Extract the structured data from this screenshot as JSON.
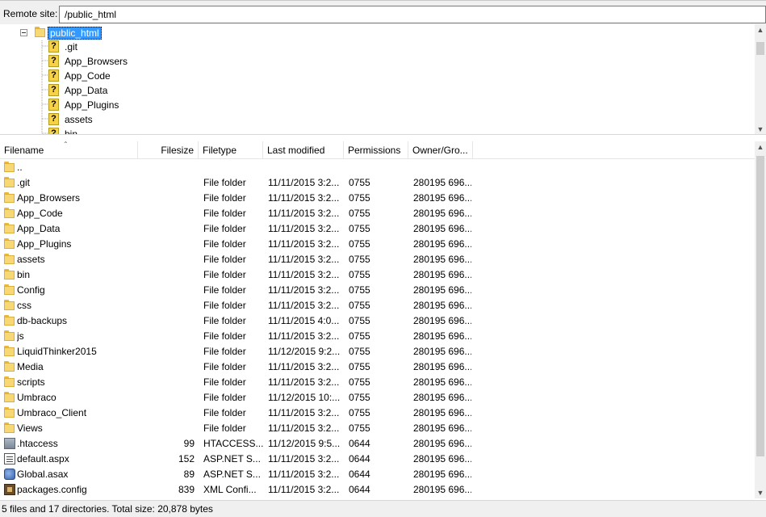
{
  "remote_site": {
    "label": "Remote site:",
    "path": "/public_html"
  },
  "tree": {
    "root": "public_html",
    "children": [
      ".git",
      "App_Browsers",
      "App_Code",
      "App_Data",
      "App_Plugins",
      "assets",
      "bin"
    ]
  },
  "file_list": {
    "columns": [
      "Filename",
      "Filesize",
      "Filetype",
      "Last modified",
      "Permissions",
      "Owner/Gro..."
    ],
    "rows": [
      {
        "name": "..",
        "size": "",
        "type": "",
        "modified": "",
        "perms": "",
        "owner": "",
        "icon": "folder-icon"
      },
      {
        "name": ".git",
        "size": "",
        "type": "File folder",
        "modified": "11/11/2015 3:2...",
        "perms": "0755",
        "owner": "280195 696...",
        "icon": "folder-icon"
      },
      {
        "name": "App_Browsers",
        "size": "",
        "type": "File folder",
        "modified": "11/11/2015 3:2...",
        "perms": "0755",
        "owner": "280195 696...",
        "icon": "folder-icon"
      },
      {
        "name": "App_Code",
        "size": "",
        "type": "File folder",
        "modified": "11/11/2015 3:2...",
        "perms": "0755",
        "owner": "280195 696...",
        "icon": "folder-icon"
      },
      {
        "name": "App_Data",
        "size": "",
        "type": "File folder",
        "modified": "11/11/2015 3:2...",
        "perms": "0755",
        "owner": "280195 696...",
        "icon": "folder-icon"
      },
      {
        "name": "App_Plugins",
        "size": "",
        "type": "File folder",
        "modified": "11/11/2015 3:2...",
        "perms": "0755",
        "owner": "280195 696...",
        "icon": "folder-icon"
      },
      {
        "name": "assets",
        "size": "",
        "type": "File folder",
        "modified": "11/11/2015 3:2...",
        "perms": "0755",
        "owner": "280195 696...",
        "icon": "folder-icon"
      },
      {
        "name": "bin",
        "size": "",
        "type": "File folder",
        "modified": "11/11/2015 3:2...",
        "perms": "0755",
        "owner": "280195 696...",
        "icon": "folder-icon"
      },
      {
        "name": "Config",
        "size": "",
        "type": "File folder",
        "modified": "11/11/2015 3:2...",
        "perms": "0755",
        "owner": "280195 696...",
        "icon": "folder-icon"
      },
      {
        "name": "css",
        "size": "",
        "type": "File folder",
        "modified": "11/11/2015 3:2...",
        "perms": "0755",
        "owner": "280195 696...",
        "icon": "folder-icon"
      },
      {
        "name": "db-backups",
        "size": "",
        "type": "File folder",
        "modified": "11/11/2015 4:0...",
        "perms": "0755",
        "owner": "280195 696...",
        "icon": "folder-icon"
      },
      {
        "name": "js",
        "size": "",
        "type": "File folder",
        "modified": "11/11/2015 3:2...",
        "perms": "0755",
        "owner": "280195 696...",
        "icon": "folder-icon"
      },
      {
        "name": "LiquidThinker2015",
        "size": "",
        "type": "File folder",
        "modified": "11/12/2015 9:2...",
        "perms": "0755",
        "owner": "280195 696...",
        "icon": "folder-icon"
      },
      {
        "name": "Media",
        "size": "",
        "type": "File folder",
        "modified": "11/11/2015 3:2...",
        "perms": "0755",
        "owner": "280195 696...",
        "icon": "folder-icon"
      },
      {
        "name": "scripts",
        "size": "",
        "type": "File folder",
        "modified": "11/11/2015 3:2...",
        "perms": "0755",
        "owner": "280195 696...",
        "icon": "folder-icon"
      },
      {
        "name": "Umbraco",
        "size": "",
        "type": "File folder",
        "modified": "11/12/2015 10:...",
        "perms": "0755",
        "owner": "280195 696...",
        "icon": "folder-icon"
      },
      {
        "name": "Umbraco_Client",
        "size": "",
        "type": "File folder",
        "modified": "11/11/2015 3:2...",
        "perms": "0755",
        "owner": "280195 696...",
        "icon": "folder-icon"
      },
      {
        "name": "Views",
        "size": "",
        "type": "File folder",
        "modified": "11/11/2015 3:2...",
        "perms": "0755",
        "owner": "280195 696...",
        "icon": "folder-icon"
      },
      {
        "name": ".htaccess",
        "size": "99",
        "type": "HTACCESS...",
        "modified": "11/12/2015 9:5...",
        "perms": "0644",
        "owner": "280195 696...",
        "icon": "htaccess-file-icon"
      },
      {
        "name": "default.aspx",
        "size": "152",
        "type": "ASP.NET S...",
        "modified": "11/11/2015 3:2...",
        "perms": "0644",
        "owner": "280195 696...",
        "icon": "aspx-file-icon"
      },
      {
        "name": "Global.asax",
        "size": "89",
        "type": "ASP.NET S...",
        "modified": "11/11/2015 3:2...",
        "perms": "0644",
        "owner": "280195 696...",
        "icon": "asax-file-icon"
      },
      {
        "name": "packages.config",
        "size": "839",
        "type": "XML Confi...",
        "modified": "11/11/2015 3:2...",
        "perms": "0644",
        "owner": "280195 696...",
        "icon": "config-file-icon"
      }
    ]
  },
  "status": {
    "text": "5 files and 17 directories. Total size: 20,878 bytes"
  }
}
